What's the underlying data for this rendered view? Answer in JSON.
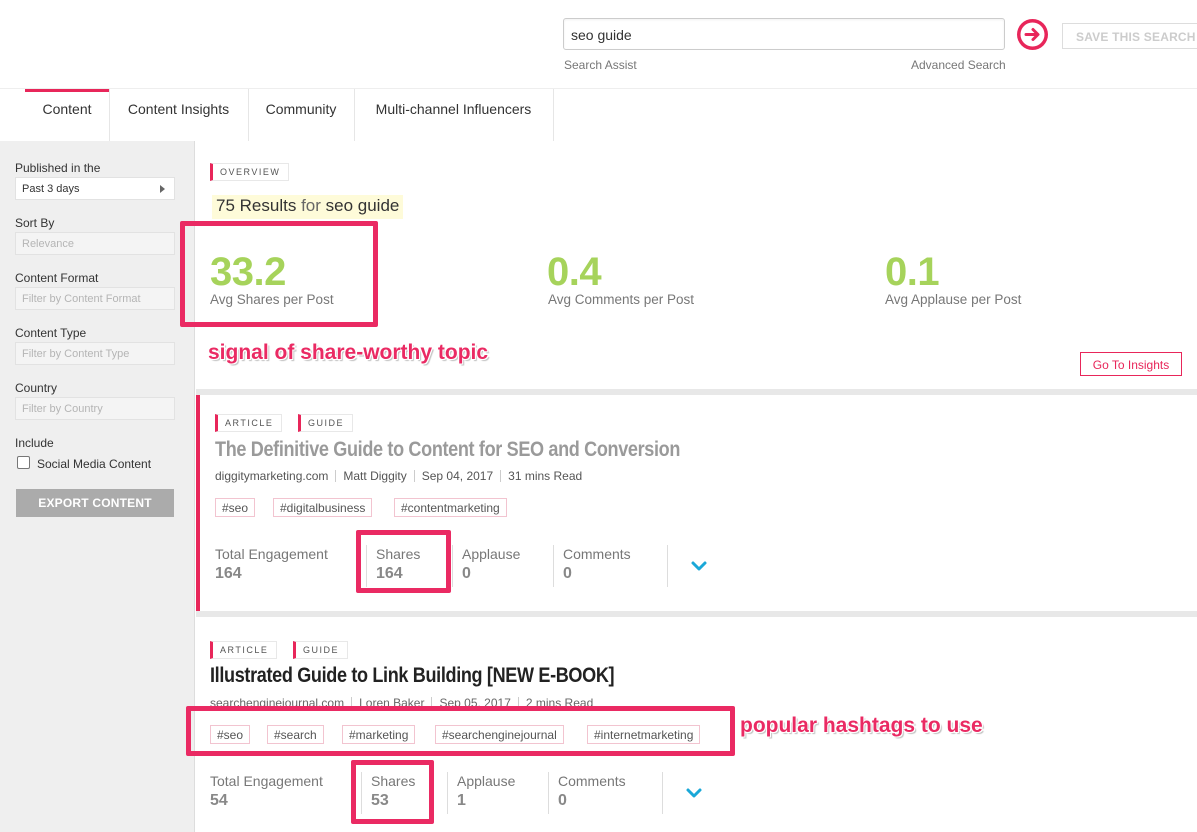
{
  "search": {
    "query": "seo guide",
    "assist_label": "Search Assist",
    "advanced_label": "Advanced Search",
    "save_label": "SAVE THIS SEARCH"
  },
  "tabs": [
    {
      "label": "Content",
      "active": true
    },
    {
      "label": "Content Insights",
      "active": false
    },
    {
      "label": "Community",
      "active": false
    },
    {
      "label": "Multi-channel Influencers",
      "active": false
    }
  ],
  "sidebar": {
    "published_label": "Published in the",
    "published_value": "Past 3 days",
    "sort_label": "Sort By",
    "sort_placeholder": "Relevance",
    "format_label": "Content Format",
    "format_placeholder": "Filter by Content Format",
    "type_label": "Content Type",
    "type_placeholder": "Filter by Content Type",
    "country_label": "Country",
    "country_placeholder": "Filter by Country",
    "include_label": "Include",
    "social_label": "Social Media Content",
    "export_label": "EXPORT CONTENT"
  },
  "overview": {
    "tag": "OVERVIEW",
    "results_count": "75 Results",
    "results_for": "for",
    "results_query": "seo guide",
    "stats": [
      {
        "value": "33.2",
        "label": "Avg Shares per Post"
      },
      {
        "value": "0.4",
        "label": "Avg Comments per Post"
      },
      {
        "value": "0.1",
        "label": "Avg Applause per Post"
      }
    ],
    "insights_button": "Go To Insights"
  },
  "articles": [
    {
      "tags": [
        "ARTICLE",
        "GUIDE"
      ],
      "title": "The Definitive Guide to Content for SEO and Conversion",
      "source": "diggitymarketing.com",
      "author": "Matt Diggity",
      "date": "Sep 04, 2017",
      "read_time": "31 mins Read",
      "hashtags": [
        "#seo",
        "#digitalbusiness",
        "#contentmarketing"
      ],
      "metrics": [
        {
          "label": "Total Engagement",
          "value": "164"
        },
        {
          "label": "Shares",
          "value": "164"
        },
        {
          "label": "Applause",
          "value": "0"
        },
        {
          "label": "Comments",
          "value": "0"
        }
      ]
    },
    {
      "tags": [
        "ARTICLE",
        "GUIDE"
      ],
      "title": "Illustrated Guide to Link Building [NEW E-BOOK]",
      "source": "searchenginejournal.com",
      "author": "Loren Baker",
      "date": "Sep 05, 2017",
      "read_time": "2 mins Read",
      "hashtags": [
        "#seo",
        "#search",
        "#marketing",
        "#searchenginejournal",
        "#internetmarketing"
      ],
      "metrics": [
        {
          "label": "Total Engagement",
          "value": "54"
        },
        {
          "label": "Shares",
          "value": "53"
        },
        {
          "label": "Applause",
          "value": "1"
        },
        {
          "label": "Comments",
          "value": "0"
        }
      ]
    }
  ],
  "annotations": {
    "share_worthy": "signal of share-worthy topic",
    "hashtags": "popular hashtags to use"
  },
  "colors": {
    "accent": "#e8265a",
    "stat_green": "#a6d35b",
    "annotation": "#ea2a63",
    "chevron": "#1aa8d8"
  }
}
